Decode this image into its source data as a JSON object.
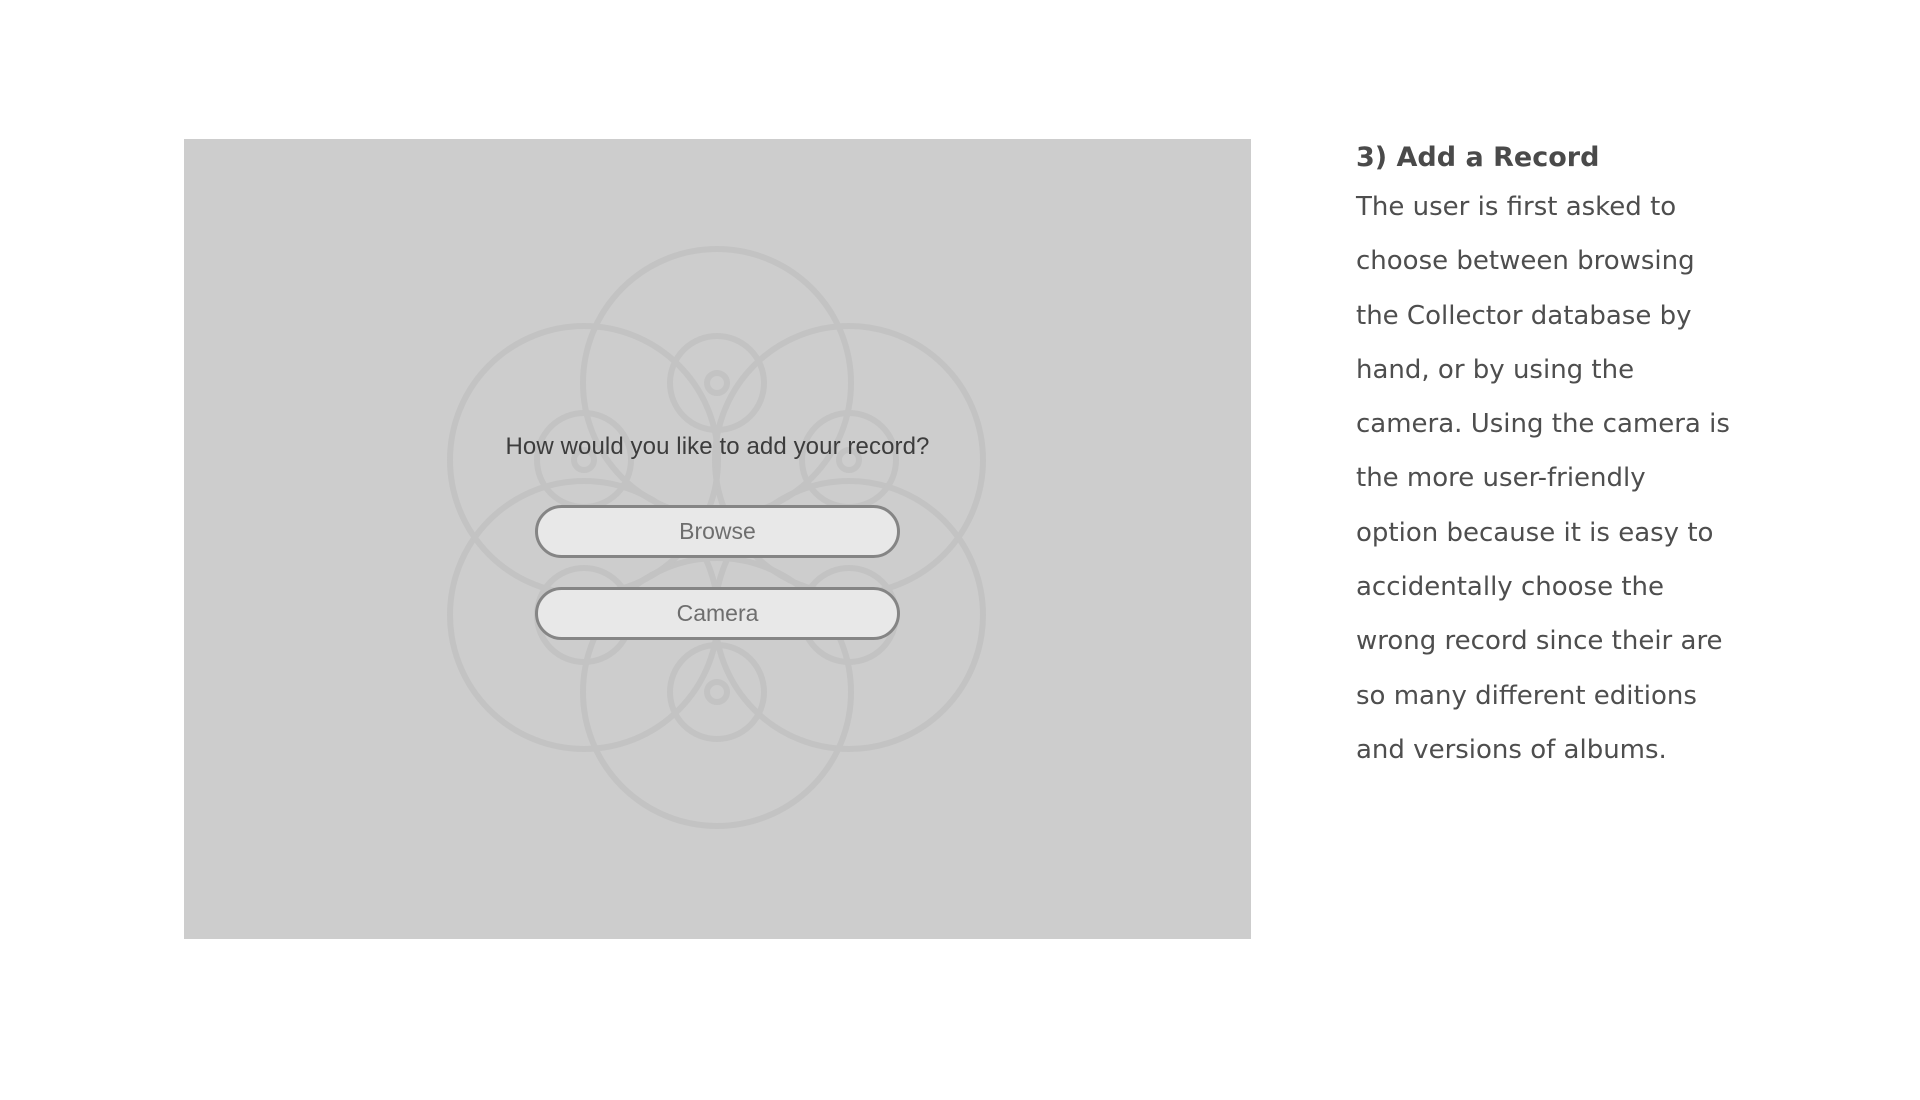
{
  "screen": {
    "background_color": "#cdcdcd",
    "prompt": "How would you like to add your record?",
    "browse_label": "Browse",
    "camera_label": "Camera",
    "logo_icon": "vinyl-records-flower-icon"
  },
  "description": {
    "title": "3) Add a Record",
    "lines": [
      "The user is first asked to",
      "choose between browsing",
      "the Collector database by",
      "hand, or by using the",
      "camera. Using the camera is",
      "the more user-friendly",
      "option because it is easy to",
      "accidentally choose the",
      "wrong record since their are",
      "so many different editions",
      "and versions of albums."
    ]
  }
}
